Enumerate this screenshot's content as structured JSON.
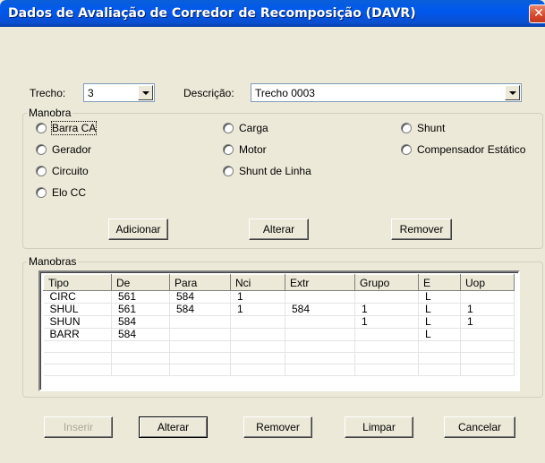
{
  "window": {
    "title": "Dados de Avaliação de Corredor de Recomposição (DAVR)",
    "close_glyph": "✕"
  },
  "trecho": {
    "label": "Trecho:",
    "value": "3"
  },
  "descricao": {
    "label": "Descrição:",
    "value": "Trecho 0003"
  },
  "manobra": {
    "legend": "Manobra",
    "options": {
      "barra_ca": "Barra CA",
      "gerador": "Gerador",
      "circuito": "Circuito",
      "elo_cc": "Elo CC",
      "carga": "Carga",
      "motor": "Motor",
      "shunt_linha": "Shunt de Linha",
      "shunt": "Shunt",
      "compensador": "Compensador Estático"
    },
    "buttons": {
      "adicionar": "Adicionar",
      "alterar": "Alterar",
      "remover": "Remover"
    }
  },
  "manobras": {
    "legend": "Manobras",
    "columns": [
      "Tipo",
      "De",
      "Para",
      "Nci",
      "Extr",
      "Grupo",
      "E",
      "Uop"
    ],
    "rows": [
      [
        "CIRC",
        "561",
        "584",
        "1",
        "",
        "",
        "L",
        ""
      ],
      [
        "SHUL",
        "561",
        "584",
        "1",
        "584",
        "1",
        "L",
        "1"
      ],
      [
        "SHUN",
        "584",
        "",
        "",
        "",
        "1",
        "L",
        "1"
      ],
      [
        "BARR",
        "584",
        "",
        "",
        "",
        "",
        "L",
        ""
      ],
      [
        "",
        "",
        "",
        "",
        "",
        "",
        "",
        ""
      ],
      [
        "",
        "",
        "",
        "",
        "",
        "",
        "",
        ""
      ],
      [
        "",
        "",
        "",
        "",
        "",
        "",
        "",
        ""
      ]
    ]
  },
  "footer": {
    "inserir": "Inserir",
    "alterar": "Alterar",
    "remover": "Remover",
    "limpar": "Limpar",
    "cancelar": "Cancelar"
  }
}
